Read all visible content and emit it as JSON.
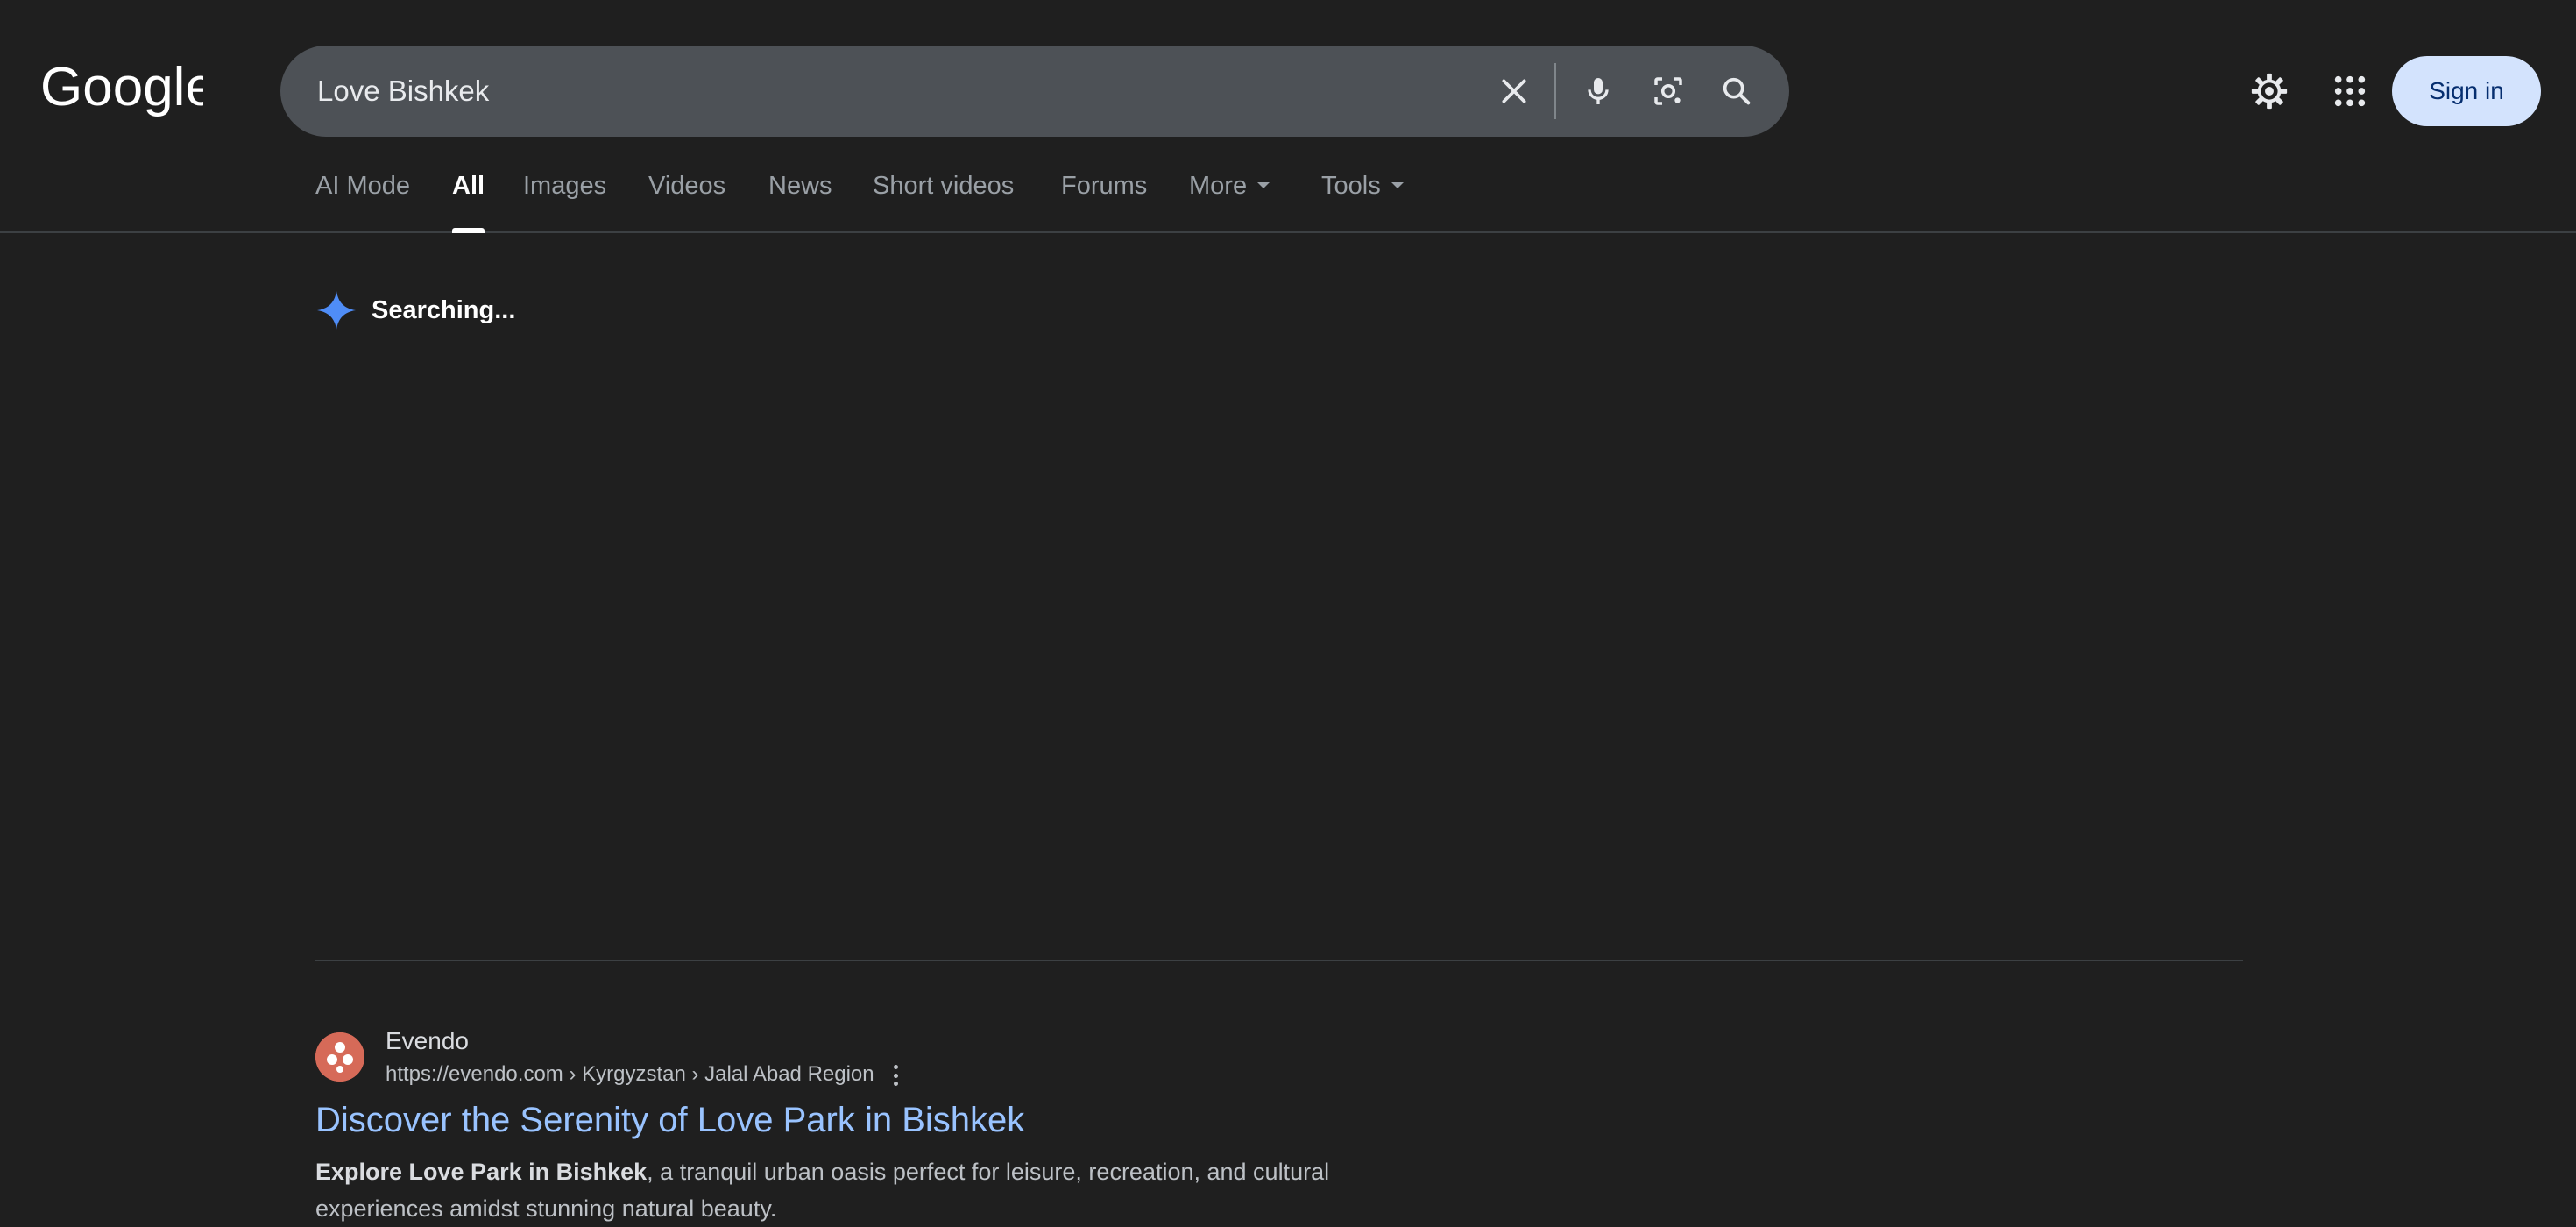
{
  "header": {
    "logo_text": "Google",
    "search": {
      "query": "Love Bishkek",
      "clear_icon": "close-icon",
      "voice_icon": "microphone-icon",
      "lens_icon": "camera-lens-icon",
      "search_icon": "search-icon"
    },
    "settings_icon": "gear-icon",
    "apps_icon": "apps-grid-icon",
    "sign_in_label": "Sign in"
  },
  "tabs": [
    {
      "label": "AI Mode",
      "active": false
    },
    {
      "label": "All",
      "active": true
    },
    {
      "label": "Images",
      "active": false
    },
    {
      "label": "Videos",
      "active": false
    },
    {
      "label": "News",
      "active": false
    },
    {
      "label": "Short videos",
      "active": false
    },
    {
      "label": "Forums",
      "active": false
    },
    {
      "label": "More",
      "active": false,
      "dropdown": true
    },
    {
      "label": "Tools",
      "active": false,
      "dropdown": true
    }
  ],
  "ai_overview": {
    "icon": "sparkle-icon",
    "status": "Searching..."
  },
  "results": [
    {
      "site_name": "Evendo",
      "url": "https://evendo.com › Kyrgyzstan › Jalal Abad Region",
      "title": "Discover the Serenity of Love Park in Bishkek",
      "snippet_bold": "Explore Love Park in Bishkek",
      "snippet_rest": ", a tranquil urban oasis perfect for leisure, recreation, and cultural experiences amidst stunning natural beauty."
    }
  ],
  "colors": {
    "background": "#1f1f1f",
    "search_bar": "#4d5156",
    "link": "#99c3ff",
    "sign_in_bg": "#d3e3fd",
    "sparkle": "#4f8df7"
  }
}
